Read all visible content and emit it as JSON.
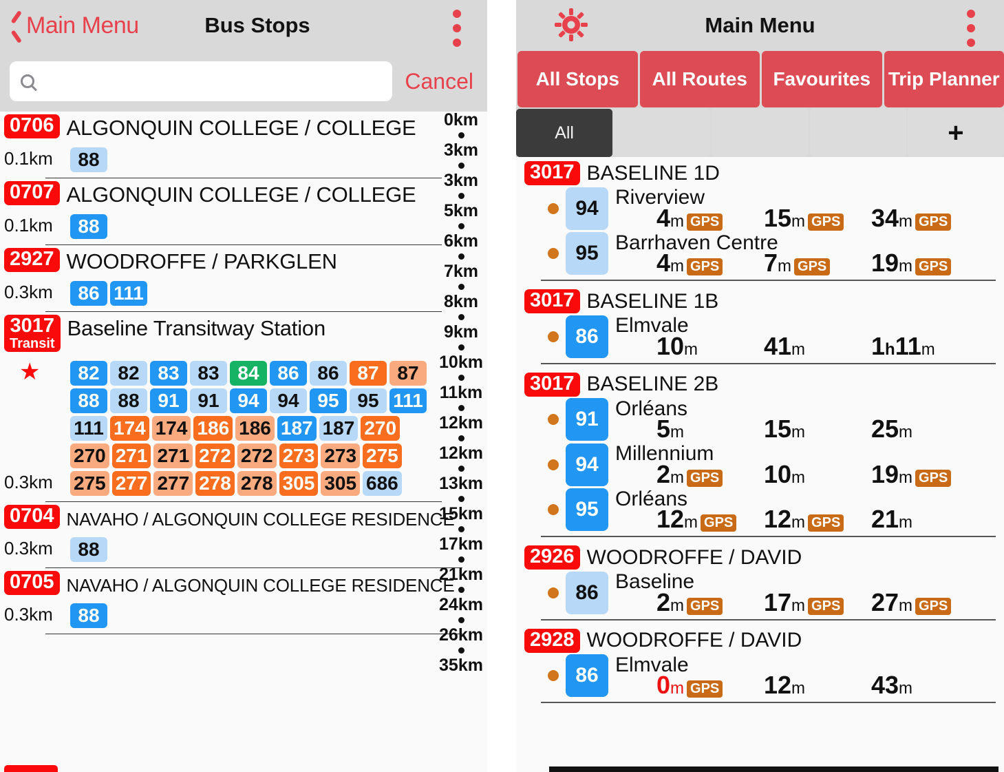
{
  "left": {
    "nav": {
      "back_label": "Main Menu",
      "title": "Bus Stops",
      "menu_icon": "kebab-menu-icon",
      "back_icon": "chevron-left-icon"
    },
    "search": {
      "value": "",
      "placeholder": "",
      "cancel_label": "Cancel",
      "icon": "search-icon"
    },
    "index_scale": [
      "0km",
      "3km",
      "3km",
      "5km",
      "6km",
      "7km",
      "8km",
      "9km",
      "10km",
      "11km",
      "12km",
      "12km",
      "13km",
      "15km",
      "17km",
      "21km",
      "24km",
      "26km",
      "35km"
    ],
    "stops": [
      {
        "code": "0706",
        "name": "ALGONQUIN COLLEGE / COLLEGE",
        "distance": "0.1km",
        "favourite": false,
        "routes": [
          {
            "label": "88",
            "style": "b-light"
          }
        ]
      },
      {
        "code": "0707",
        "name": "ALGONQUIN COLLEGE / COLLEGE",
        "distance": "0.1km",
        "favourite": false,
        "routes": [
          {
            "label": "88",
            "style": "b-dark"
          }
        ]
      },
      {
        "code": "2927",
        "name": "WOODROFFE / PARKGLEN",
        "distance": "0.3km",
        "favourite": false,
        "routes": [
          {
            "label": "86",
            "style": "b-dark"
          },
          {
            "label": "111",
            "style": "b-dark"
          }
        ]
      },
      {
        "code": "3017",
        "code_sub": "Transit",
        "name": "Baseline Transitway Station",
        "distance": "0.3km",
        "favourite": true,
        "favourite_icon": "star-icon",
        "routes": [
          {
            "label": "82",
            "style": "b-dark"
          },
          {
            "label": "82",
            "style": "b-light"
          },
          {
            "label": "83",
            "style": "b-dark"
          },
          {
            "label": "83",
            "style": "b-light"
          },
          {
            "label": "84",
            "style": "g-dark"
          },
          {
            "label": "86",
            "style": "b-dark"
          },
          {
            "label": "86",
            "style": "b-light"
          },
          {
            "label": "87",
            "style": "o-dark"
          },
          {
            "label": "87",
            "style": "o-light"
          },
          {
            "label": "88",
            "style": "b-dark"
          },
          {
            "label": "88",
            "style": "b-light"
          },
          {
            "label": "91",
            "style": "b-dark"
          },
          {
            "label": "91",
            "style": "b-light"
          },
          {
            "label": "94",
            "style": "b-dark"
          },
          {
            "label": "94",
            "style": "b-light"
          },
          {
            "label": "95",
            "style": "b-dark"
          },
          {
            "label": "95",
            "style": "b-light"
          },
          {
            "label": "111",
            "style": "b-dark"
          },
          {
            "label": "111",
            "style": "b-light"
          },
          {
            "label": "174",
            "style": "o-dark"
          },
          {
            "label": "174",
            "style": "o-light"
          },
          {
            "label": "186",
            "style": "o-dark"
          },
          {
            "label": "186",
            "style": "o-light"
          },
          {
            "label": "187",
            "style": "b-dark"
          },
          {
            "label": "187",
            "style": "b-light"
          },
          {
            "label": "270",
            "style": "o-dark"
          },
          {
            "label": "270",
            "style": "o-light"
          },
          {
            "label": "271",
            "style": "o-dark"
          },
          {
            "label": "271",
            "style": "o-light"
          },
          {
            "label": "272",
            "style": "o-dark"
          },
          {
            "label": "272",
            "style": "o-light"
          },
          {
            "label": "273",
            "style": "o-dark"
          },
          {
            "label": "273",
            "style": "o-light"
          },
          {
            "label": "275",
            "style": "o-dark"
          },
          {
            "label": "275",
            "style": "o-light"
          },
          {
            "label": "277",
            "style": "o-dark"
          },
          {
            "label": "277",
            "style": "o-light"
          },
          {
            "label": "278",
            "style": "o-dark"
          },
          {
            "label": "278",
            "style": "o-light"
          },
          {
            "label": "305",
            "style": "o-dark"
          },
          {
            "label": "305",
            "style": "o-light"
          },
          {
            "label": "686",
            "style": "b-light"
          }
        ]
      },
      {
        "code": "0704",
        "name": "NAVAHO / ALGONQUIN COLLEGE RESIDENCE",
        "distance": "0.3km",
        "favourite": false,
        "routes": [
          {
            "label": "88",
            "style": "b-light"
          }
        ]
      },
      {
        "code": "0705",
        "name": "NAVAHO / ALGONQUIN COLLEGE RESIDENCE",
        "distance": "0.3km",
        "favourite": false,
        "routes": [
          {
            "label": "88",
            "style": "b-dark"
          }
        ]
      }
    ]
  },
  "right": {
    "nav": {
      "settings_icon": "gear-icon",
      "title": "Main Menu",
      "menu_icon": "kebab-menu-icon"
    },
    "tabs": [
      {
        "label": "All Stops",
        "active": true
      },
      {
        "label": "All Routes",
        "active": false
      },
      {
        "label": "Favourites",
        "active": false
      },
      {
        "label": "Trip Planner",
        "active": false
      }
    ],
    "segments": [
      {
        "label": "All",
        "active": true
      },
      {
        "label": "",
        "active": false
      },
      {
        "label": "",
        "active": false
      },
      {
        "label": "",
        "active": false
      },
      {
        "label": "+",
        "active": false,
        "icon": "plus-icon"
      }
    ],
    "groups": [
      {
        "code": "3017",
        "name": "BASELINE 1D",
        "trips": [
          {
            "route": "94",
            "route_style": "light",
            "destination": "Riverview",
            "times": [
              {
                "value": "4",
                "unit": "m",
                "gps": "GPS"
              },
              {
                "value": "15",
                "unit": "m",
                "gps": "GPS"
              },
              {
                "value": "34",
                "unit": "m",
                "gps": "GPS"
              }
            ]
          },
          {
            "route": "95",
            "route_style": "light",
            "destination": "Barrhaven Centre",
            "times": [
              {
                "value": "4",
                "unit": "m",
                "gps": "GPS"
              },
              {
                "value": "7",
                "unit": "m",
                "gps": "GPS"
              },
              {
                "value": "19",
                "unit": "m",
                "gps": "GPS"
              }
            ]
          }
        ]
      },
      {
        "code": "3017",
        "name": "BASELINE 1B",
        "trips": [
          {
            "route": "86",
            "route_style": "dark",
            "destination": "Elmvale",
            "times": [
              {
                "value": "10",
                "unit": "m",
                "gps": ""
              },
              {
                "value": "41",
                "unit": "m",
                "gps": ""
              },
              {
                "value": "1h11",
                "unit": "m",
                "gps": ""
              }
            ]
          }
        ]
      },
      {
        "code": "3017",
        "name": "BASELINE 2B",
        "trips": [
          {
            "route": "91",
            "route_style": "dark",
            "destination": "Orléans",
            "times": [
              {
                "value": "5",
                "unit": "m",
                "gps": ""
              },
              {
                "value": "15",
                "unit": "m",
                "gps": ""
              },
              {
                "value": "25",
                "unit": "m",
                "gps": ""
              }
            ]
          },
          {
            "route": "94",
            "route_style": "dark",
            "destination": "Millennium",
            "times": [
              {
                "value": "2",
                "unit": "m",
                "gps": "GPS"
              },
              {
                "value": "10",
                "unit": "m",
                "gps": ""
              },
              {
                "value": "19",
                "unit": "m",
                "gps": "GPS"
              }
            ]
          },
          {
            "route": "95",
            "route_style": "dark",
            "destination": "Orléans",
            "times": [
              {
                "value": "12",
                "unit": "m",
                "gps": "GPS"
              },
              {
                "value": "12",
                "unit": "m",
                "gps": "GPS"
              },
              {
                "value": "21",
                "unit": "m",
                "gps": ""
              }
            ]
          }
        ]
      },
      {
        "code": "2926",
        "name": "WOODROFFE / DAVID",
        "trips": [
          {
            "route": "86",
            "route_style": "light",
            "destination": "Baseline",
            "times": [
              {
                "value": "2",
                "unit": "m",
                "gps": "GPS"
              },
              {
                "value": "17",
                "unit": "m",
                "gps": "GPS"
              },
              {
                "value": "27",
                "unit": "m",
                "gps": "GPS"
              }
            ]
          }
        ]
      },
      {
        "code": "2928",
        "name": "WOODROFFE / DAVID",
        "trips": [
          {
            "route": "86",
            "route_style": "dark",
            "destination": "Elmvale",
            "times": [
              {
                "value": "0",
                "unit": "m",
                "gps": "GPS",
                "alert": true
              },
              {
                "value": "12",
                "unit": "m",
                "gps": ""
              },
              {
                "value": "43",
                "unit": "m",
                "gps": ""
              }
            ]
          }
        ]
      }
    ]
  },
  "colors": {
    "brand_red": "#fb0a0a",
    "nav_red": "#e8414b",
    "tab_red": "#dd4b55",
    "route_blue_dark": "#2196f3",
    "route_blue_light": "#b8d8f8",
    "route_orange_dark": "#f96d1f",
    "route_orange_light": "#f9aa7f",
    "route_green": "#16b365",
    "gps_badge": "#c96a16",
    "bullet_orange": "#d2761e",
    "nav_bg": "#d9d9d9",
    "list_bg": "#fafafa"
  }
}
